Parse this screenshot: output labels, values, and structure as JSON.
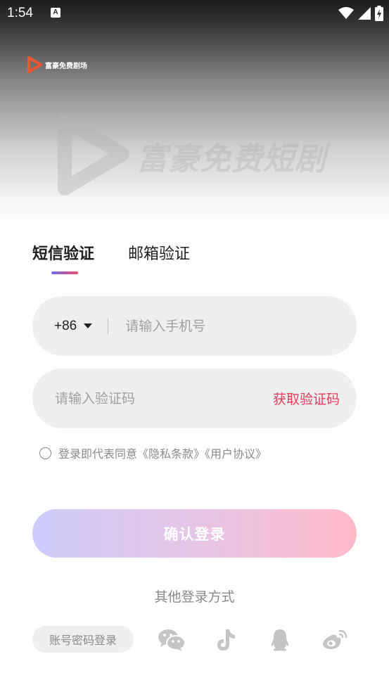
{
  "status_bar": {
    "time": "1:54",
    "a_icon": "A"
  },
  "brand": {
    "small_name": "富豪免费剧场",
    "watermark_text": "富豪免费短剧"
  },
  "tabs": [
    {
      "label": "短信验证",
      "active": true
    },
    {
      "label": "邮箱验证",
      "active": false
    }
  ],
  "phone": {
    "country_code": "+86",
    "placeholder": "请输入手机号",
    "value": ""
  },
  "code": {
    "placeholder": "请输入验证码",
    "value": "",
    "get_code_label": "获取验证码"
  },
  "agreement": {
    "text": "登录即代表同意《隐私条款》《用户协议》"
  },
  "login_button": {
    "label": "确认登录"
  },
  "other_login": {
    "title": "其他登录方式",
    "password_login_label": "账号密码登录",
    "icons": [
      "wechat-icon",
      "tiktok-icon",
      "qq-icon",
      "weibo-icon"
    ]
  },
  "colors": {
    "accent_red": "#e8385b",
    "gradient_start": "#cccbfb",
    "gradient_end": "#ffbac8",
    "field_bg": "#efefef"
  }
}
